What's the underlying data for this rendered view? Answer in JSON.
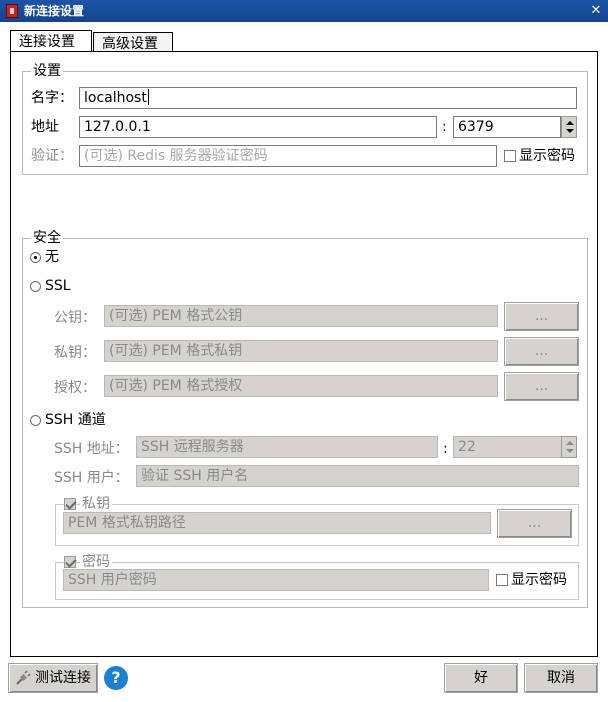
{
  "window": {
    "title": "新连接设置",
    "close_icon": "close-icon"
  },
  "tabs": [
    {
      "label": "连接设置",
      "active": true
    },
    {
      "label": "高级设置",
      "active": false
    }
  ],
  "settings": {
    "group_label": "设置",
    "name_label": "名字：",
    "name_value": "localhost",
    "address_label": "地址",
    "host_value": "127.0.0.1",
    "port_separator": ":",
    "port_value": "6379",
    "auth_label": "验证：",
    "auth_placeholder": "(可选) Redis 服务器验证密码",
    "show_password_label": "显示密码",
    "show_password_checked": false
  },
  "security": {
    "group_label": "安全",
    "options": [
      {
        "label": "无",
        "selected": true
      },
      {
        "label": "SSL",
        "selected": false
      },
      {
        "label": "SSH 通道",
        "selected": false
      }
    ],
    "ssl": {
      "public_key_label": "公钥：",
      "public_key_placeholder": "(可选) PEM 格式公钥",
      "private_key_label": "私钥：",
      "private_key_placeholder": "(可选) PEM 格式私钥",
      "authority_label": "授权：",
      "authority_placeholder": "(可选) PEM 格式授权",
      "browse_label": "..."
    },
    "ssh": {
      "address_label": "SSH 地址：",
      "address_placeholder": "SSH 远程服务器",
      "port_separator": ":",
      "port_value": "22",
      "user_label": "SSH 用户：",
      "user_placeholder": "验证 SSH 用户名",
      "private_key_group_label": "私钥",
      "private_key_checked": true,
      "private_key_placeholder": "PEM 格式私钥路径",
      "browse_label": "...",
      "password_group_label": "密码",
      "password_checked": true,
      "password_placeholder": "SSH 用户密码",
      "show_password_label": "显示密码",
      "show_password_checked": false
    }
  },
  "footer": {
    "test_connection_label": "测试连接",
    "help_symbol": "?",
    "ok_label": "好",
    "cancel_label": "取消"
  },
  "colors": {
    "titlebar": "#15448e",
    "disabled_field": "#d6d3ce",
    "help_icon": "#1a7fd6"
  }
}
